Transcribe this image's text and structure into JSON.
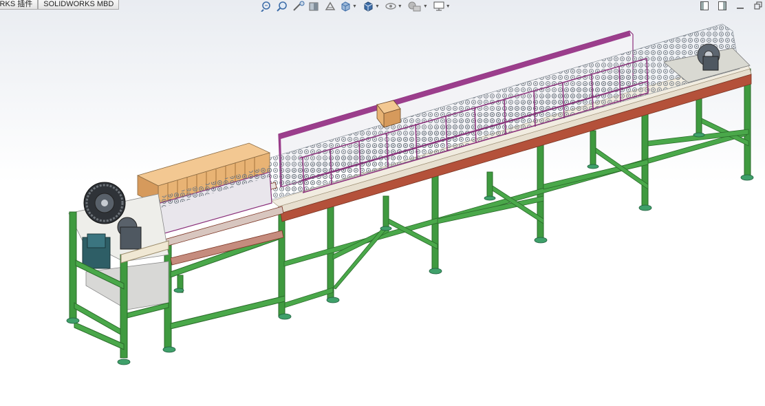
{
  "tabs": [
    {
      "label": "ORKS 插件"
    },
    {
      "label": "SOLIDWORKS MBD"
    }
  ],
  "heads_up_toolbar": {
    "tools": [
      {
        "icon": "zoom-to-fit-icon"
      },
      {
        "icon": "zoom-to-area-icon"
      },
      {
        "icon": "previous-view-icon"
      },
      {
        "icon": "section-view-icon"
      },
      {
        "icon": "dynamic-annotation-icon"
      },
      {
        "icon": "view-orientation-icon",
        "dropdown": true
      },
      {
        "icon": "display-style-icon",
        "dropdown": true
      },
      {
        "icon": "hide-show-items-icon",
        "dropdown": true
      },
      {
        "icon": "edit-appearance-icon",
        "dropdown": true
      },
      {
        "icon": "view-settings-icon",
        "dropdown": true
      }
    ]
  },
  "window_controls": [
    {
      "icon": "tile-left-icon"
    },
    {
      "icon": "tile-right-icon"
    },
    {
      "icon": "minimize-icon"
    },
    {
      "icon": "restore-icon"
    }
  ],
  "model": {
    "description_icon": "conveyor-assembly-3d-model",
    "colors": {
      "frame": "#3f9a3f",
      "frame_dark": "#2a6b2a",
      "feet": "#3fa06a",
      "rail": "#b4513a",
      "guard": "#8a2f7a",
      "blocks": "#e8b374",
      "chain": "#9aa3ad",
      "motor": "#2e5e66"
    }
  }
}
